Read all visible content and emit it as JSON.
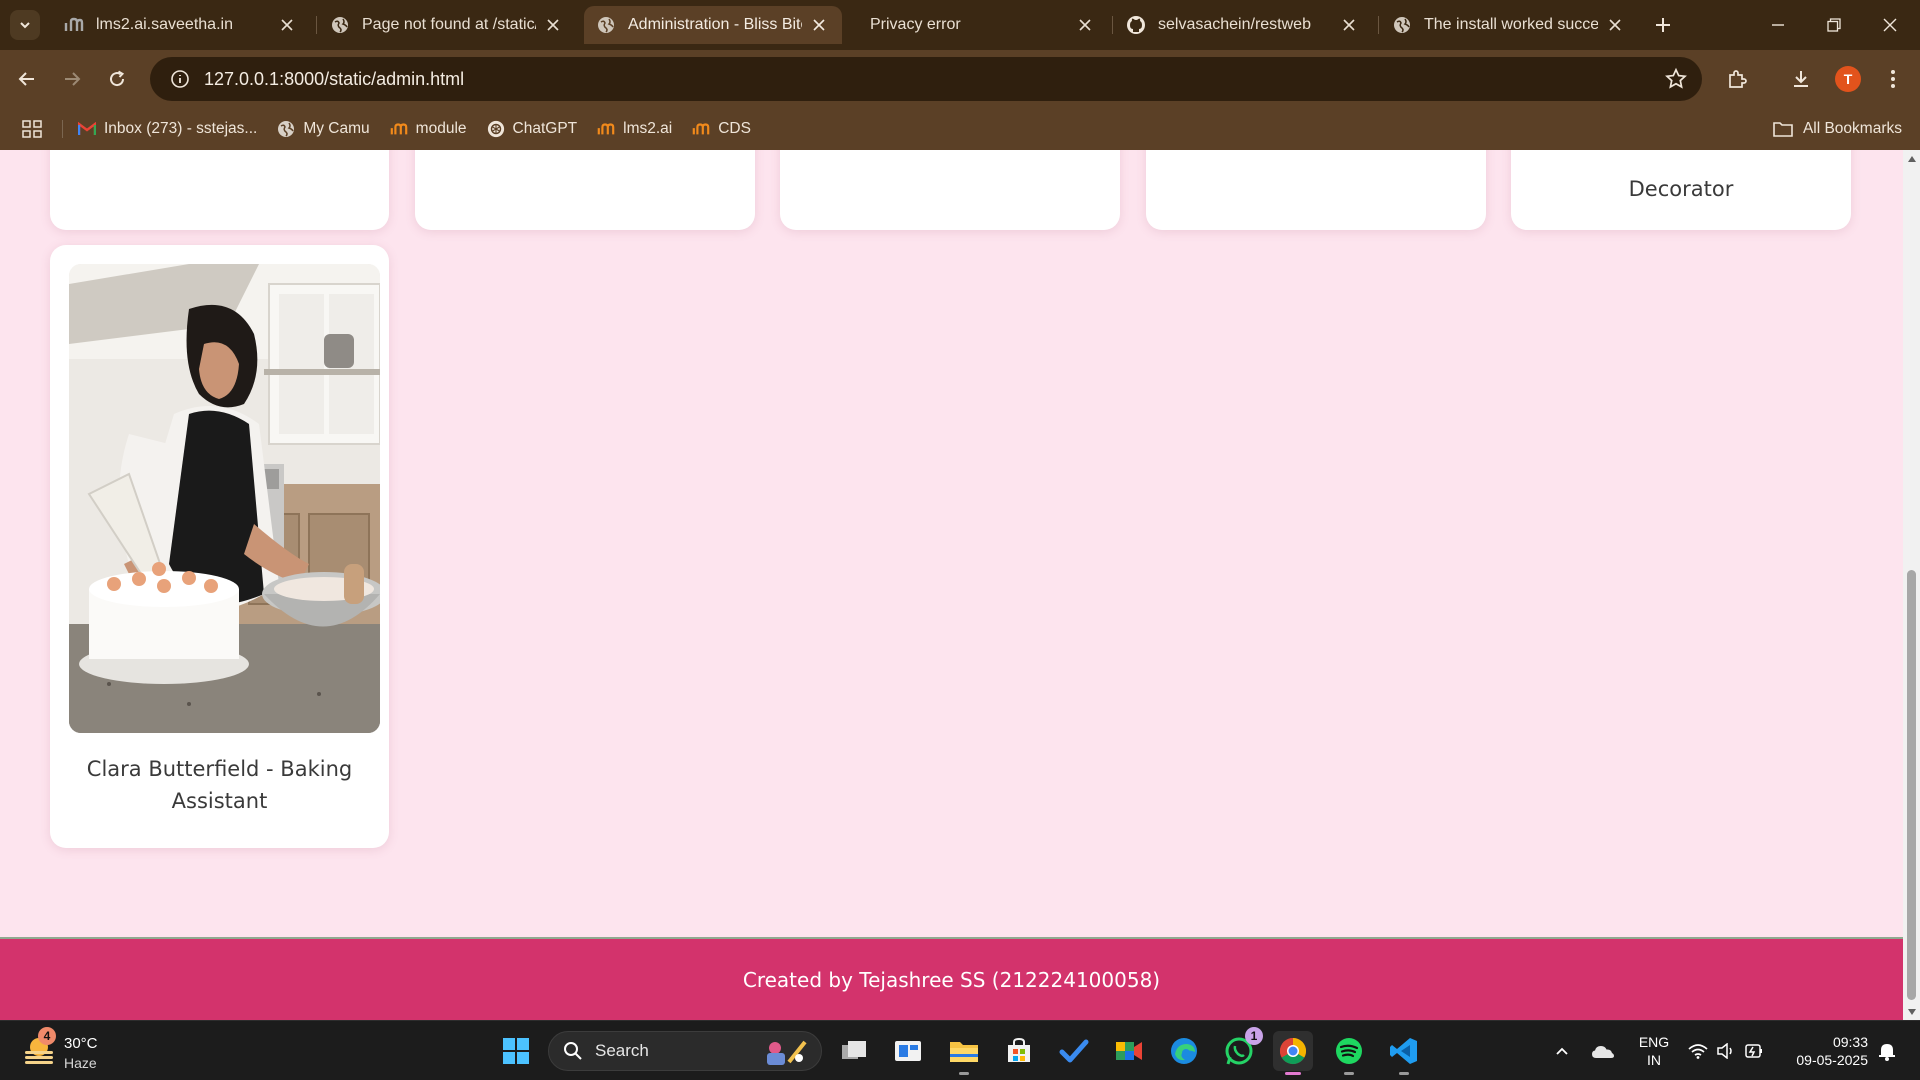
{
  "browser": {
    "tabs": [
      {
        "title": "lms2.ai.saveetha.in",
        "icon": "lms-icon",
        "active": false
      },
      {
        "title": "Page not found at /static/index",
        "icon": "globe-icon",
        "active": false
      },
      {
        "title": "Administration - Bliss Bites",
        "icon": "globe-icon",
        "active": true
      },
      {
        "title": "Privacy error",
        "icon": "none",
        "active": false
      },
      {
        "title": "selvasachein/restweb",
        "icon": "github-icon",
        "active": false
      },
      {
        "title": "The install worked successfully",
        "icon": "globe-icon",
        "active": false
      }
    ],
    "address": "127.0.0.1:8000/static/admin.html",
    "profile_initial": "T",
    "bookmarks": [
      {
        "label": "Inbox (273) - sstejas...",
        "icon": "gmail-icon"
      },
      {
        "label": "My Camu",
        "icon": "globe-icon"
      },
      {
        "label": "module",
        "icon": "lms-icon"
      },
      {
        "label": "ChatGPT",
        "icon": "chatgpt-icon"
      },
      {
        "label": "lms2.ai",
        "icon": "lms-icon"
      },
      {
        "label": "CDS",
        "icon": "lms-icon"
      }
    ],
    "all_bookmarks": "All Bookmarks"
  },
  "page": {
    "top_row_caption": "Decorator",
    "card": {
      "caption_line1": "Clara Butterfield - Baking",
      "caption_line2": "Assistant",
      "photo": "woman-piping-cake-photo"
    },
    "footer": "Created by Tejashree SS (212224100058)"
  },
  "taskbar": {
    "weather_badge": "4",
    "temperature": "30°C",
    "condition": "Haze",
    "search_label": "Search",
    "whatsapp_badge": "1",
    "language_line1": "ENG",
    "language_line2": "IN",
    "time": "09:33",
    "date": "09-05-2025"
  },
  "colors": {
    "page_background": "#fde4ee",
    "footer": "#d3336c",
    "browser_frame": "#5b4026"
  }
}
